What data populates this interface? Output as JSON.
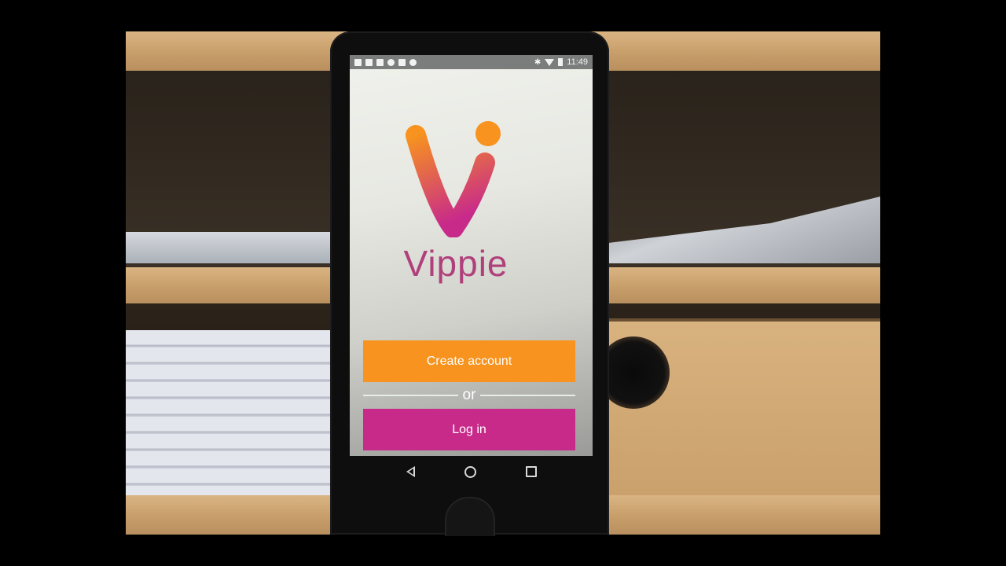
{
  "status_bar": {
    "time": "11:49",
    "icons_left": [
      "facebook-icon",
      "facebook-icon",
      "tools-icon",
      "info-icon",
      "lock-icon",
      "android-icon"
    ],
    "icons_right": [
      "bluetooth-icon",
      "wifi-icon",
      "battery-icon"
    ]
  },
  "app": {
    "name": "Vippie",
    "logo_colors": {
      "top": "#f7931e",
      "bottom": "#c82a8a"
    },
    "create_account_label": "Create account",
    "or_label": "or",
    "login_label": "Log in"
  },
  "colors": {
    "create_button": "#f7931e",
    "login_button": "#c82a8a",
    "brand_text": "#b0407b"
  },
  "nav_bar": {
    "icons": [
      "back-icon",
      "home-icon",
      "recent-apps-icon"
    ]
  }
}
